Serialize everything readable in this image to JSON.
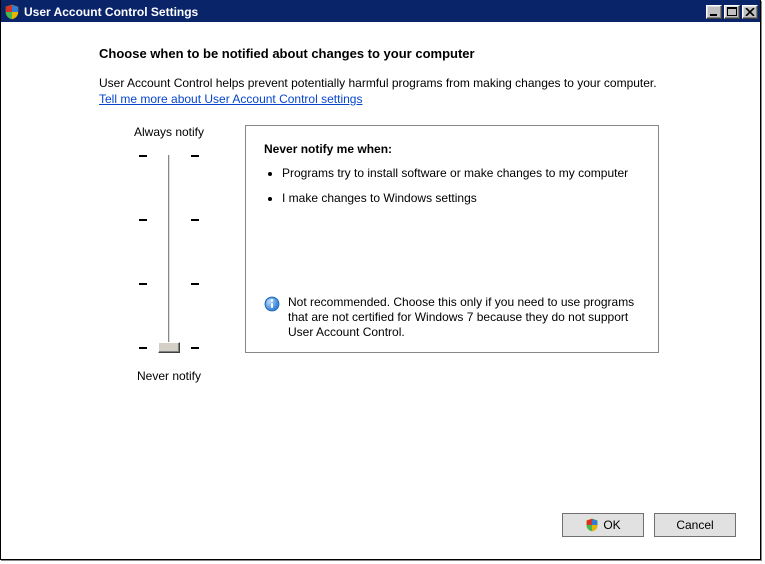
{
  "window": {
    "title": "User Account Control Settings"
  },
  "page": {
    "title": "Choose when to be notified about changes to your computer",
    "description": "User Account Control helps prevent potentially harmful programs from making changes to your computer.",
    "help_link": "Tell me more about User Account Control settings"
  },
  "slider": {
    "top_label": "Always notify",
    "bottom_label": "Never notify",
    "position_index": 3,
    "levels": 4
  },
  "panel": {
    "heading": "Never notify me when:",
    "bullets": [
      "Programs try to install software or make changes to my computer",
      "I make changes to Windows settings"
    ],
    "note": "Not recommended. Choose this only if you need to use programs that are not certified for Windows 7 because they do not support User Account Control."
  },
  "buttons": {
    "ok": "OK",
    "cancel": "Cancel"
  }
}
